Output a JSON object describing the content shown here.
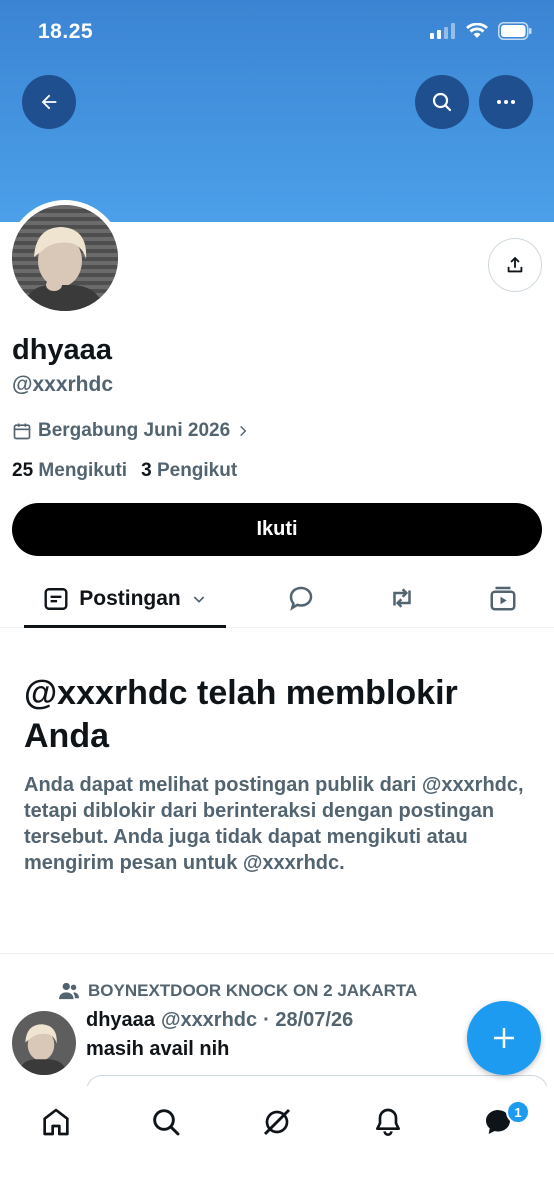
{
  "status_bar": {
    "time": "18.25"
  },
  "profile": {
    "display_name": "dhyaaa",
    "handle": "@xxxrhdc",
    "joined": "Bergabung Juni 2026",
    "following_count": "25",
    "following_label": "Mengikuti",
    "followers_count": "3",
    "followers_label": "Pengikut",
    "follow_button": "Ikuti"
  },
  "tabs": {
    "active_label": "Postingan"
  },
  "blocked": {
    "title": "@xxxrhdc telah memblokir Anda",
    "body": "Anda dapat melihat postingan publik dari @xxxrhdc, tetapi diblokir dari berinteraksi dengan postingan tersebut. Anda juga tidak dapat mengikuti atau mengirim pesan untuk @xxxrhdc."
  },
  "post": {
    "community": "BOYNEXTDOOR KNOCK ON 2 JAKARTA",
    "author_name": "dhyaaa",
    "author_handle": "@xxxrhdc",
    "date": "· 28/07/26",
    "text": "masih avail nih"
  },
  "nav": {
    "messages_badge": "1"
  },
  "colors": {
    "banner": "#4a97e2",
    "accent": "#1d9bf0",
    "secondary_text": "#536471"
  }
}
